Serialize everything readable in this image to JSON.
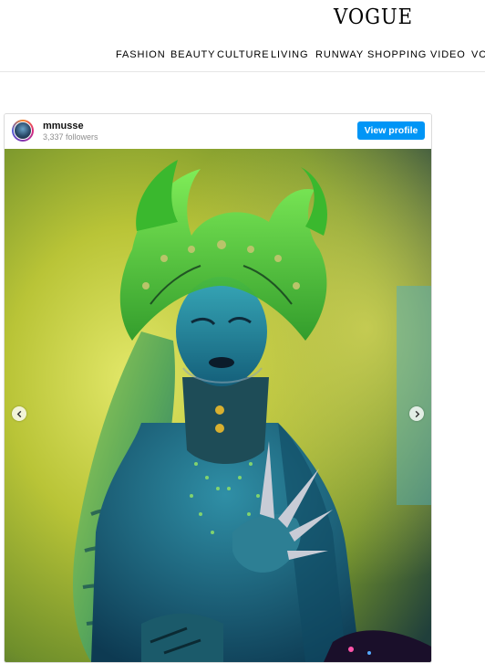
{
  "site": {
    "logo": "VOGUE"
  },
  "nav": {
    "items": [
      {
        "label": "FASHION",
        "name": "fashion"
      },
      {
        "label": "BEAUTY",
        "name": "beauty"
      },
      {
        "label": "CULTURE",
        "name": "culture"
      },
      {
        "label": "LIVING",
        "name": "living"
      },
      {
        "label": "RUNWAY",
        "name": "runway"
      },
      {
        "label": "SHOPPING",
        "name": "shopping"
      },
      {
        "label": "VIDEO",
        "name": "video"
      },
      {
        "label": "VC",
        "name": "vogue-club-truncated"
      }
    ]
  },
  "embed": {
    "username": "mmusse",
    "followers": "3,337 followers",
    "view_profile": "View profile",
    "icons": {
      "prev": "chevron-left-icon",
      "next": "chevron-right-icon"
    },
    "colors": {
      "accent": "#0095f6",
      "crown": "#46c83a",
      "backdrop": "#c9cf3a"
    }
  }
}
